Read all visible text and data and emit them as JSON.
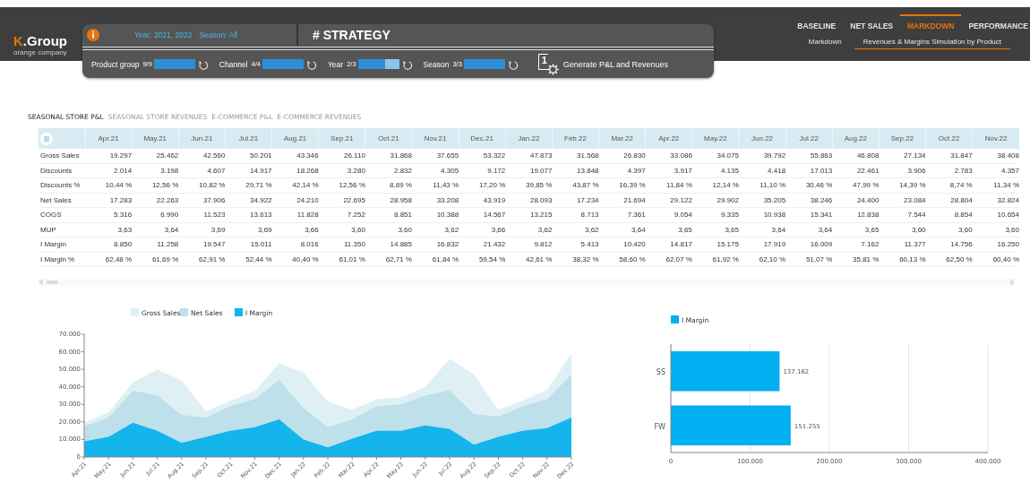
{
  "logo": {
    "mark": "K",
    "name": ".Group",
    "tagline": "orange company"
  },
  "panel": {
    "summary": [
      "Year: 2021, 2022",
      "Season: All"
    ],
    "title": "# STRATEGY",
    "filters": [
      {
        "label": "Product group",
        "count": "9/9",
        "level": 1
      },
      {
        "label": "Channel",
        "count": "4/4",
        "level": 1
      },
      {
        "label": "Year",
        "count": "2/3",
        "level": 0.67
      },
      {
        "label": "Season",
        "count": "3/3",
        "level": 1
      }
    ],
    "generate_button": {
      "icon_text": "1",
      "label": "Generate P&L and Revenues"
    }
  },
  "nav": {
    "tabs": [
      {
        "label": "BASELINE",
        "selected": false
      },
      {
        "label": "NET SALES",
        "selected": false
      },
      {
        "label": "MARKDOWN",
        "selected": true
      },
      {
        "label": "PERFORMANCE",
        "selected": false
      }
    ],
    "subtabs": [
      {
        "label": "Markdown",
        "selected": false
      },
      {
        "label": "Revenues & Margins Simulation by Product",
        "selected": true
      }
    ]
  },
  "report_tabs": [
    {
      "label": "SEASONAL STORE P&L",
      "selected": true
    },
    {
      "label": "SEASONAL STORE REVENUES",
      "selected": false
    },
    {
      "label": "E-COMMERCE P&L",
      "selected": false
    },
    {
      "label": "E-COMMERCE REVENUES",
      "selected": false
    }
  ],
  "table": {
    "columns": [
      "Apr.21",
      "May.21",
      "Jun.21",
      "Jul.21",
      "Aug.21",
      "Sep.21",
      "Oct.21",
      "Nov.21",
      "Dec.21",
      "Jan.22",
      "Feb.22",
      "Mar.22",
      "Apr.22",
      "May.22",
      "Jun.22",
      "Jul.22",
      "Aug.22",
      "Sep.22",
      "Oct.22",
      "Nov.22"
    ],
    "rows": [
      {
        "label": "Gross Sales",
        "cells": [
          "19.297",
          "25.462",
          "42.560",
          "50.201",
          "43.346",
          "26.110",
          "31.868",
          "37.655",
          "53.322",
          "47.873",
          "31.568",
          "26.830",
          "33.086",
          "34.075",
          "39.792",
          "55.863",
          "46.808",
          "27.134",
          "31.847",
          "38.408"
        ]
      },
      {
        "label": "Discounts",
        "cells": [
          "2.014",
          "3.198",
          "4.607",
          "14.917",
          "18.268",
          "3.280",
          "2.832",
          "4.305",
          "9.172",
          "19.077",
          "13.848",
          "4.397",
          "3.917",
          "4.135",
          "4.418",
          "17.013",
          "22.461",
          "3.906",
          "2.783",
          "4.357"
        ]
      },
      {
        "label": "Discounts %",
        "cells": [
          "10,44 %",
          "12,56 %",
          "10,82 %",
          "29,71 %",
          "42,14 %",
          "12,56 %",
          "8,89 %",
          "11,43 %",
          "17,20 %",
          "39,85 %",
          "43,87 %",
          "16,39 %",
          "11,84 %",
          "12,14 %",
          "11,10 %",
          "30,46 %",
          "47,99 %",
          "14,39 %",
          "8,74 %",
          "11,34 %"
        ]
      },
      {
        "label": "Net Sales",
        "cells": [
          "17.283",
          "22.263",
          "37.906",
          "34.922",
          "24.210",
          "22.695",
          "28.958",
          "33.208",
          "43.919",
          "28.093",
          "17.234",
          "21.694",
          "29.122",
          "29.902",
          "35.205",
          "38.246",
          "24.400",
          "23.084",
          "28.804",
          "32.824"
        ]
      },
      {
        "label": "COGS",
        "cells": [
          "5.316",
          "6.990",
          "11.523",
          "13.613",
          "11.828",
          "7.252",
          "8.851",
          "10.388",
          "14.567",
          "13.215",
          "8.713",
          "7.361",
          "9.054",
          "9.335",
          "10.938",
          "15.341",
          "12.838",
          "7.544",
          "8.854",
          "10.654"
        ]
      },
      {
        "label": "MUP",
        "cells": [
          "3,63",
          "3,64",
          "3,69",
          "3,69",
          "3,66",
          "3,60",
          "3,60",
          "3,62",
          "3,66",
          "3,62",
          "3,62",
          "3,64",
          "3,65",
          "3,65",
          "3,64",
          "3,64",
          "3,65",
          "3,60",
          "3,60",
          "3,60"
        ]
      },
      {
        "label": "I Margin",
        "cells": [
          "8.850",
          "11.258",
          "19.547",
          "15.011",
          "8.016",
          "11.350",
          "14.885",
          "16.832",
          "21.432",
          "9.812",
          "5.413",
          "10.420",
          "14.817",
          "15.175",
          "17.919",
          "16.009",
          "7.162",
          "11.377",
          "14.756",
          "16.250"
        ]
      },
      {
        "label": "I Margin %",
        "cells": [
          "62,48 %",
          "61,69 %",
          "62,91 %",
          "52,44 %",
          "40,40 %",
          "61,01 %",
          "62,71 %",
          "61,84 %",
          "59,54 %",
          "42,61 %",
          "38,32 %",
          "58,60 %",
          "62,07 %",
          "61,92 %",
          "62,10 %",
          "51,07 %",
          "35,81 %",
          "60,13 %",
          "62,50 %",
          "60,40 %"
        ]
      }
    ]
  },
  "area_chart": {
    "chart_data": {
      "type": "area",
      "stacked": false,
      "categories": [
        "Apr.21",
        "May.21",
        "Jun.21",
        "Jul.21",
        "Aug.21",
        "Sep.21",
        "Oct.21",
        "Nov.21",
        "Dec.21",
        "Jan.22",
        "Feb.22",
        "Mar.22",
        "Apr.22",
        "May.22",
        "Jun.22",
        "Jul.22",
        "Aug.22",
        "Sep.22",
        "Oct.22",
        "Nov.22",
        "Dec.22"
      ],
      "legend": true,
      "series": [
        {
          "name": "Gross Sales",
          "color": "#dff0f5",
          "values": [
            19500,
            25500,
            42500,
            50000,
            43500,
            26000,
            32000,
            37500,
            53500,
            48000,
            31500,
            27000,
            33000,
            34000,
            40000,
            56000,
            47000,
            27000,
            32000,
            38500,
            59000
          ]
        },
        {
          "name": "Net Sales",
          "color": "#bde0ea",
          "values": [
            17500,
            22500,
            38000,
            35000,
            24000,
            22500,
            29000,
            33000,
            44000,
            28000,
            17000,
            21500,
            29000,
            30000,
            35000,
            38000,
            24500,
            23000,
            29000,
            33000,
            47000
          ]
        },
        {
          "name": "I Margin",
          "color": "#14b4ec",
          "values": [
            9000,
            11500,
            19500,
            15000,
            8000,
            11500,
            15000,
            17000,
            21500,
            10000,
            5500,
            10500,
            15000,
            15000,
            18000,
            16000,
            7000,
            11500,
            15000,
            16500,
            22500
          ]
        }
      ],
      "ylim": [
        0,
        70000
      ],
      "yticks": [
        {
          "value": 0,
          "label": "0"
        },
        {
          "value": 10000,
          "label": "10.000"
        },
        {
          "value": 20000,
          "label": "20.000"
        },
        {
          "value": 30000,
          "label": "30.000"
        },
        {
          "value": 40000,
          "label": "40.000"
        },
        {
          "value": 50000,
          "label": "50.000"
        },
        {
          "value": 60000,
          "label": "60.000"
        },
        {
          "value": 70000,
          "label": "70.000"
        }
      ]
    }
  },
  "bar_chart": {
    "chart_data": {
      "type": "bar",
      "orientation": "horizontal",
      "legend": true,
      "grid": true,
      "categories": [
        "SS",
        "FW"
      ],
      "series": [
        {
          "name": "I Margin",
          "color": "#00b0f0",
          "values": [
            137162,
            151255
          ]
        }
      ],
      "value_labels": [
        "137.162",
        "151.255"
      ],
      "xlim": [
        0,
        400000
      ],
      "xticks": [
        {
          "value": 0,
          "label": "0"
        },
        {
          "value": 100000,
          "label": "100.000"
        },
        {
          "value": 200000,
          "label": "200.000"
        },
        {
          "value": 300000,
          "label": "300.000"
        },
        {
          "value": 400000,
          "label": "400.000"
        }
      ]
    }
  }
}
